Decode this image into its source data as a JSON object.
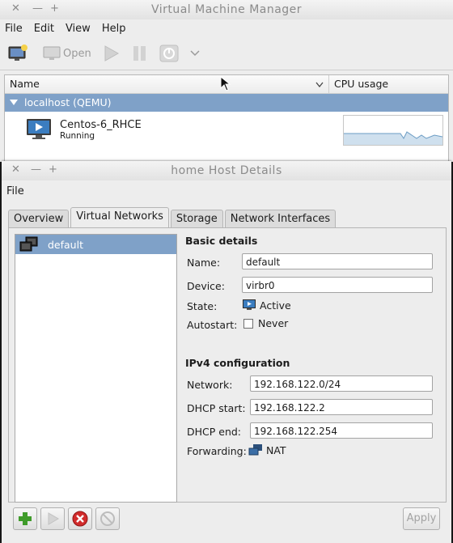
{
  "main": {
    "title": "Virtual Machine Manager",
    "menu": [
      "File",
      "Edit",
      "View",
      "Help"
    ],
    "toolbar": {
      "open_label": "Open"
    },
    "columns": {
      "name": "Name",
      "cpu": "CPU usage"
    },
    "group": "localhost (QEMU)",
    "vm": {
      "name": "Centos-6_RHCE",
      "status": "Running"
    }
  },
  "host": {
    "title": "home Host Details",
    "menu": [
      "File"
    ],
    "tabs": [
      "Overview",
      "Virtual Networks",
      "Storage",
      "Network Interfaces"
    ],
    "active_tab": "Virtual Networks",
    "networks": [
      "default"
    ],
    "basic": {
      "heading": "Basic details",
      "name_label": "Name:",
      "name_value": "default",
      "device_label": "Device:",
      "device_value": "virbr0",
      "state_label": "State:",
      "state_value": "Active",
      "autostart_label": "Autostart:",
      "autostart_value": "Never",
      "autostart_checked": false
    },
    "ipv4": {
      "heading": "IPv4 configuration",
      "network_label": "Network:",
      "network_value": "192.168.122.0/24",
      "dhcp_start_label": "DHCP start:",
      "dhcp_start_value": "192.168.122.2",
      "dhcp_end_label": "DHCP end:",
      "dhcp_end_value": "192.168.122.254",
      "forwarding_label": "Forwarding:",
      "forwarding_value": "NAT"
    },
    "apply_label": "Apply"
  },
  "colors": {
    "selection": "#7fa1c8",
    "add_green": "#3f9b2a",
    "delete_red": "#d12b2b"
  }
}
